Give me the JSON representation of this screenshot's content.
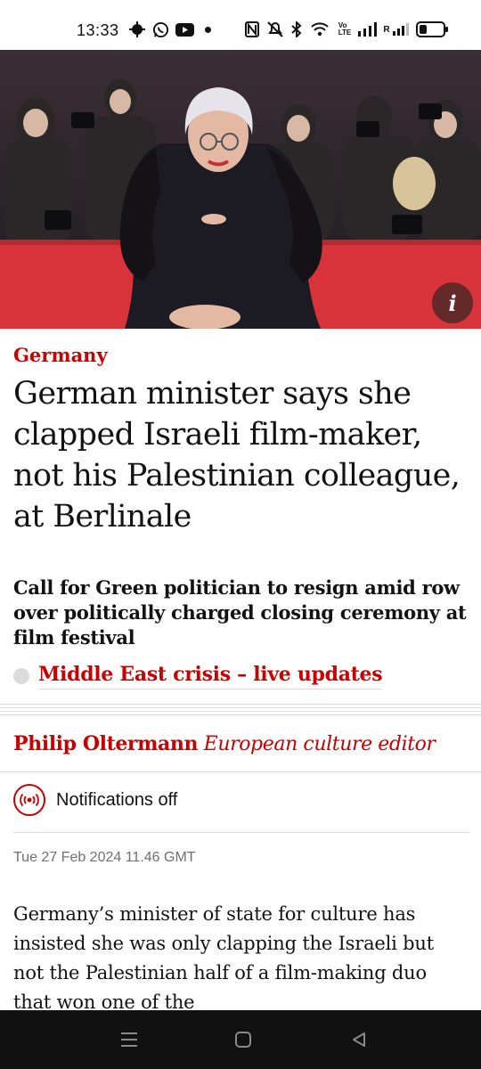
{
  "status_bar": {
    "time": "13:33",
    "icons": [
      "bug-icon",
      "whatsapp-icon",
      "youtube-icon",
      "dot-icon",
      "nfc-icon",
      "mute-icon",
      "bluetooth-icon",
      "wifi-icon",
      "volte-icon",
      "signal-icon",
      "signal-icon-2",
      "battery-icon"
    ],
    "volte_label": "Vo\nLTE",
    "roaming_label": "R"
  },
  "hero": {
    "info_label": "i",
    "colors": {
      "carpet": "#d8323a",
      "dress": "#1c1a22"
    }
  },
  "article": {
    "kicker": "Germany",
    "headline": "German minister says she clapped Israeli film-maker, not his Palestinian colleague, at Berlinale",
    "standfirst": "Call for Green politician to resign amid row over politically charged closing ceremony at film festival",
    "live_link": "Middle East crisis – live updates",
    "author": "Philip Oltermann",
    "author_role": "European culture editor",
    "notifications_label": "Notifications off",
    "date": "Tue 27 Feb 2024 11.46 GMT",
    "body_start": "Germany’s minister of state for culture has insisted she was only clapping the Israeli but not the Palestinian half of a film-making duo that won one of the"
  },
  "colors": {
    "accent": "#c70000",
    "text": "#121212",
    "muted": "#707070",
    "divider": "#dcdcdc"
  },
  "nav": {
    "icons": [
      "menu-icon",
      "home-icon",
      "back-icon"
    ]
  }
}
